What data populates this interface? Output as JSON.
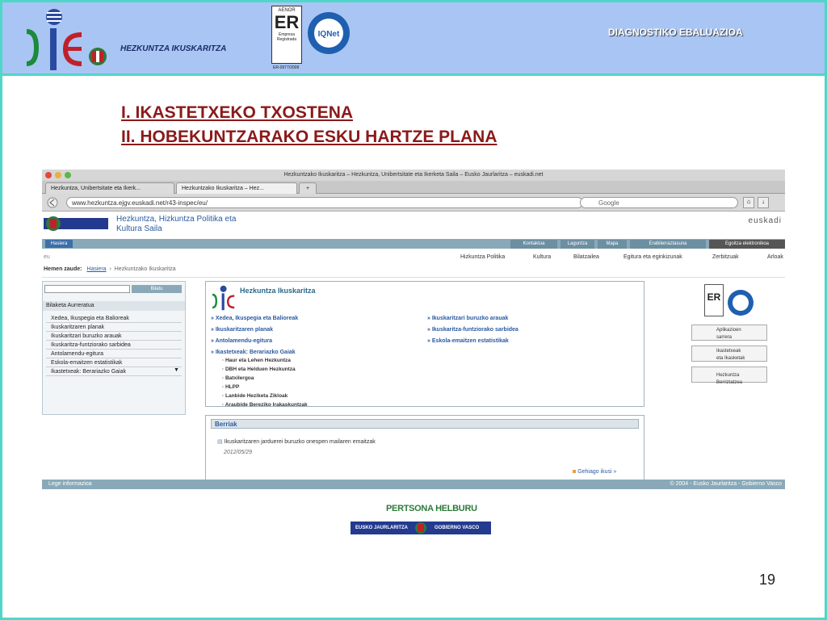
{
  "header": {
    "org": "HEZKUNTZA IKUSKARITZA",
    "title": "DIAGNOSTIKO EBALUAZIOA",
    "aenor": "AENOR",
    "aenor_mark": "ER",
    "aenor_sub": "Empresa Registrada",
    "iqnet": "IQNet",
    "cert_code": "ER-0977/2008"
  },
  "slide": {
    "title1": "I. IKASTETXEKO TXOSTENA",
    "title2": "II. HOBEKUNTZARAKO ESKU HARTZE PLANA",
    "page_number": "19",
    "persona": "PERTSONA HELBURU",
    "gov_left": "EUSKO JAURLARITZA",
    "gov_right": "GOBIERNO VASCO"
  },
  "browser": {
    "window_title": "Hezkuntzako Ikuskaritza – Hezkuntza, Unibertsitate eta Ikerketa Saila – Eusko Jaurlaritza – euskadi.net",
    "tabs": [
      {
        "label": "Hezkuntza, Unibertsitate eta Ikerk..."
      },
      {
        "label": "Hezkuntzako Ikuskaritza – Hez..."
      }
    ],
    "new_tab": "+",
    "url": "www.hezkuntza.ejgv.euskadi.net/r43-inspec/eu/",
    "search_placeholder": "Google"
  },
  "site": {
    "dept_name": "Hezkuntza, Hizkuntza Politika eta Kultura Saila",
    "euskadi": "euskadi",
    "hasiera": "Hasiera",
    "nav_tabs": [
      "Kontaktua",
      "Laguntza",
      "Mapa",
      "Erabilerraztasuna",
      "Egoitza elektronikoa"
    ],
    "lang": "eu",
    "sub_nav": [
      "Hizkuntza Politika",
      "Kultura",
      "Bilatzailea",
      "Egitura eta eginkizunak",
      "Zerbitzuak",
      "Arloak"
    ],
    "breadcrumb_label": "Hemen zaude:",
    "breadcrumb_home": "Hasiera",
    "breadcrumb_current": "Hezkuntzako Ikuskaritza",
    "side_search_btn": "Bilatu",
    "side_heading": "Bilaketa Aurreratua",
    "side_items": [
      "Xedea, Ikuspegia eta Balioreak",
      "Ikuskaritzaren planak",
      "Ikuskaritzari buruzko arauak",
      "Ikuskaritza-funtziorako sarbidea",
      "Antolamendu-egitura",
      "Eskola-emaitzen estatistikak",
      "Ikastetxeak: Berariazko Gaiak"
    ],
    "main_heading": "Hezkuntza Ikuskaritza",
    "main_links_left": [
      "Xedea, Ikuspegia eta Balioreak",
      "Ikuskaritzaren planak",
      "Antolamendu-egitura",
      "Ikastetxeak: Berariazko Gaiak"
    ],
    "main_links_right": [
      "Ikuskaritzari buruzko arauak",
      "Ikuskaritza-funtziorako sarbidea",
      "Eskola-emaitzen estatistikak"
    ],
    "main_subs": [
      "Haur eta Lehen Hezkuntza",
      "DBH eta Helduen Hezkuntza",
      "Batxilergoa",
      "HLPP",
      "Lanbide Heziketa Zikloak",
      "Araubide Bereziko Irakaskuntzak"
    ],
    "news_heading": "Berriak",
    "news_item": "Ikuskaritzaren jarduerei buruzko onespen mailaren emaitzak",
    "news_date": "2012/05/29",
    "news_more": "Gehiago ikusi",
    "right_btns": [
      [
        "Aplikazioen",
        "sarrera"
      ],
      [
        "Ikastetxeak",
        "eta Ikasketak"
      ],
      [
        "Hezkuntza Berriztatzea",
        ""
      ]
    ],
    "footer_left": "Lege informazioa",
    "footer_right": "© 2004 - Eusko Jaurlaritza - Gobierno Vasco"
  },
  "colors": {
    "header_bg": "#a9c5f3",
    "frame": "#4fd6c8",
    "title_red": "#8b1a1a",
    "nav_blue": "#8aa9b8"
  }
}
